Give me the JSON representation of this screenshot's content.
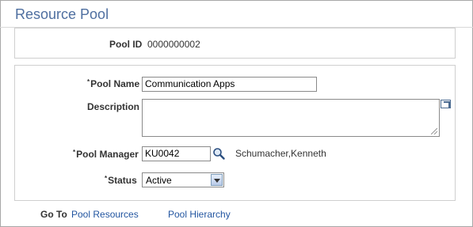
{
  "page": {
    "title": "Resource Pool"
  },
  "pool_id": {
    "label": "Pool ID",
    "value": "0000000002"
  },
  "form": {
    "required_mark": "*",
    "pool_name": {
      "label": "Pool Name",
      "value": "Communication Apps"
    },
    "description": {
      "label": "Description",
      "value": ""
    },
    "pool_manager": {
      "label": "Pool Manager",
      "value": "KU0042",
      "name": "Schumacher,Kenneth"
    },
    "status": {
      "label": "Status",
      "selected": "Active"
    }
  },
  "goto": {
    "label": "Go To",
    "links": [
      "Pool Resources",
      "Pool Hierarchy"
    ]
  },
  "icons": [
    "expand-icon",
    "search-icon",
    "chevron-down-icon",
    "resize-grip-icon"
  ],
  "colors": {
    "title": "#4f6fa0",
    "link": "#2255a0",
    "border": "#cfcfcf"
  }
}
